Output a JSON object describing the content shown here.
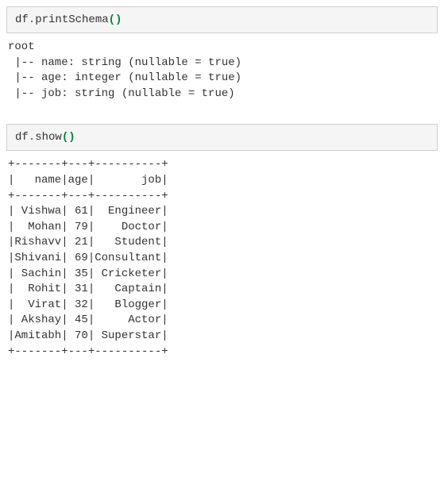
{
  "cell1": {
    "id": "df",
    "dot": ".",
    "method": "printSchema",
    "lparen": "(",
    "rparen": ")"
  },
  "schemaOutput": "root\n |-- name: string (nullable = true)\n |-- age: integer (nullable = true)\n |-- job: string (nullable = true)",
  "cell2": {
    "id": "df",
    "dot": ".",
    "method": "show",
    "lparen": "(",
    "rparen": ")"
  },
  "tableText": "+-------+---+----------+\n|   name|age|       job|\n+-------+---+----------+\n| Vishwa| 61|  Engineer|\n|  Mohan| 79|    Doctor|\n|Rishavv| 21|   Student|\n|Shivani| 69|Consultant|\n| Sachin| 35| Cricketer|\n|  Rohit| 31|   Captain|\n|  Virat| 32|   Blogger|\n| Akshay| 45|     Actor|\n|Amitabh| 70| Superstar|\n+-------+---+----------+",
  "chart_data": {
    "type": "table",
    "title": "",
    "columns": [
      "name",
      "age",
      "job"
    ],
    "schema": [
      {
        "field": "name",
        "type": "string",
        "nullable": true
      },
      {
        "field": "age",
        "type": "integer",
        "nullable": true
      },
      {
        "field": "job",
        "type": "string",
        "nullable": true
      }
    ],
    "rows": [
      {
        "name": "Vishwa",
        "age": 61,
        "job": "Engineer"
      },
      {
        "name": "Mohan",
        "age": 79,
        "job": "Doctor"
      },
      {
        "name": "Rishavv",
        "age": 21,
        "job": "Student"
      },
      {
        "name": "Shivani",
        "age": 69,
        "job": "Consultant"
      },
      {
        "name": "Sachin",
        "age": 35,
        "job": "Cricketer"
      },
      {
        "name": "Rohit",
        "age": 31,
        "job": "Captain"
      },
      {
        "name": "Virat",
        "age": 32,
        "job": "Blogger"
      },
      {
        "name": "Akshay",
        "age": 45,
        "job": "Actor"
      },
      {
        "name": "Amitabh",
        "age": 70,
        "job": "Superstar"
      }
    ]
  }
}
